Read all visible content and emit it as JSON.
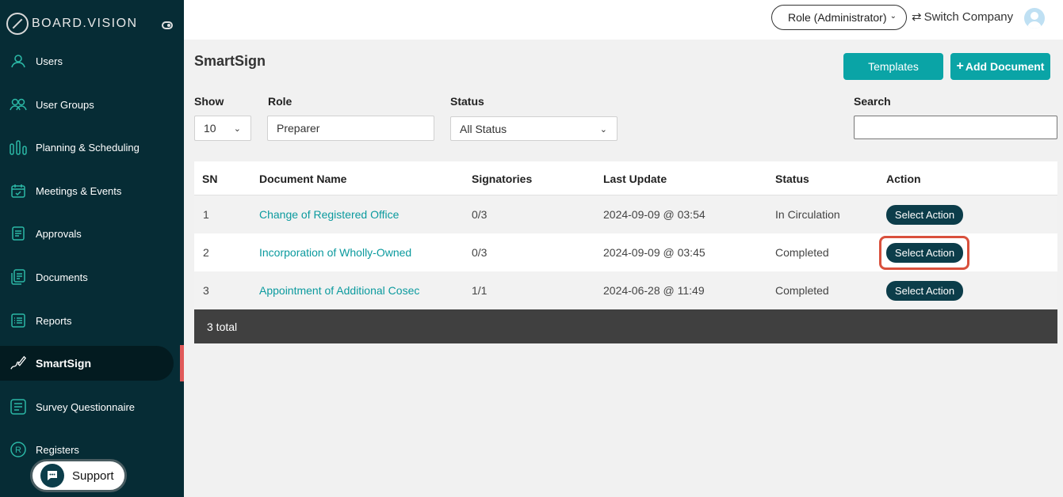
{
  "brand": {
    "name": "BOARD.VISION"
  },
  "sidebar": {
    "items": [
      {
        "label": "Users",
        "icon": "user-icon"
      },
      {
        "label": "User Groups",
        "icon": "user-group-icon"
      },
      {
        "label": "Planning & Scheduling",
        "icon": "bar-chart-icon"
      },
      {
        "label": "Meetings & Events",
        "icon": "calendar-icon"
      },
      {
        "label": "Approvals",
        "icon": "approval-doc-icon"
      },
      {
        "label": "Documents",
        "icon": "documents-icon"
      },
      {
        "label": "Reports",
        "icon": "report-list-icon"
      },
      {
        "label": "SmartSign",
        "icon": "signature-pen-icon",
        "active": true
      },
      {
        "label": "Survey Questionnaire",
        "icon": "survey-icon"
      },
      {
        "label": "Registers",
        "icon": "registered-icon"
      }
    ],
    "support_label": "Support"
  },
  "header": {
    "role_label": "Role (Administrator)",
    "switch_company_label": "Switch Company"
  },
  "page": {
    "title": "SmartSign",
    "templates_label": "Templates",
    "add_document_label": "Add Document"
  },
  "filters": {
    "show_label": "Show",
    "show_value": "10",
    "role_label": "Role",
    "role_value": "Preparer",
    "status_label": "Status",
    "status_value": "All Status",
    "search_label": "Search",
    "search_value": ""
  },
  "table": {
    "columns": [
      "SN",
      "Document Name",
      "Signatories",
      "Last Update",
      "Status",
      "Action"
    ],
    "rows": [
      {
        "sn": "1",
        "name": "Change of Registered Office",
        "signatories": "0/3",
        "updated": "2024-09-09 @ 03:54",
        "status": "In Circulation",
        "action": "Select Action"
      },
      {
        "sn": "2",
        "name": "Incorporation of Wholly-Owned",
        "signatories": "0/3",
        "updated": "2024-09-09 @ 03:45",
        "status": "Completed",
        "action": "Select Action"
      },
      {
        "sn": "3",
        "name": "Appointment of Additional Cosec",
        "signatories": "1/1",
        "updated": "2024-06-28 @ 11:49",
        "status": "Completed",
        "action": "Select Action"
      }
    ],
    "footer": "3 total"
  },
  "colors": {
    "sidebar_bg": "#062c35",
    "accent_teal": "#0aa4a6",
    "action_button": "#0c3d4a",
    "highlight": "#d9503c"
  }
}
